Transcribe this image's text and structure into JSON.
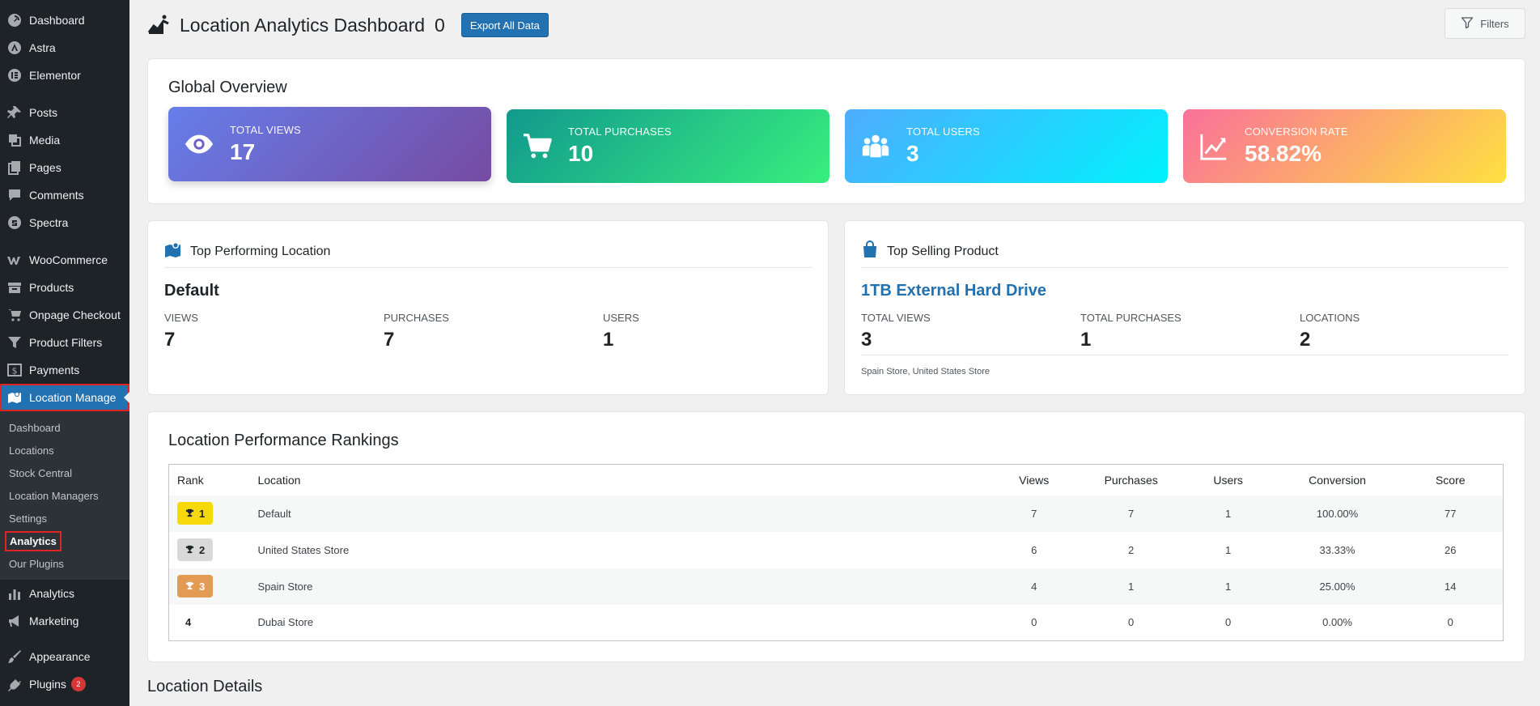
{
  "sidebar": {
    "top_items": [
      {
        "label": "Dashboard",
        "icon": "dashboard-icon"
      },
      {
        "label": "Astra",
        "icon": "astra-icon"
      },
      {
        "label": "Elementor",
        "icon": "elementor-icon"
      }
    ],
    "content_items": [
      {
        "label": "Posts",
        "icon": "pin-icon"
      },
      {
        "label": "Media",
        "icon": "media-icon"
      },
      {
        "label": "Pages",
        "icon": "pages-icon"
      },
      {
        "label": "Comments",
        "icon": "comment-icon"
      },
      {
        "label": "Spectra",
        "icon": "spectra-icon"
      }
    ],
    "shop_items": [
      {
        "label": "WooCommerce",
        "icon": "woocommerce-icon"
      },
      {
        "label": "Products",
        "icon": "archive-icon"
      },
      {
        "label": "Onpage Checkout",
        "icon": "cart-icon"
      },
      {
        "label": "Product Filters",
        "icon": "filter-icon"
      },
      {
        "label": "Payments",
        "icon": "dollar-icon"
      }
    ],
    "current_item": {
      "label": "Location Manage",
      "icon": "map-icon"
    },
    "submenu": [
      "Dashboard",
      "Locations",
      "Stock Central",
      "Location Managers",
      "Settings",
      "Analytics",
      "Our Plugins"
    ],
    "submenu_active": "Analytics",
    "bottom_items": [
      {
        "label": "Analytics",
        "icon": "bar-chart-icon"
      },
      {
        "label": "Marketing",
        "icon": "megaphone-icon"
      }
    ],
    "appearance": {
      "label": "Appearance",
      "icon": "brush-icon"
    },
    "plugins": {
      "label": "Plugins",
      "icon": "plug-icon",
      "badge": "2"
    }
  },
  "header": {
    "title": "Location Analytics Dashboard",
    "count": "0",
    "export_label": "Export All Data",
    "filters_label": "Filters"
  },
  "overview": {
    "heading": "Global Overview",
    "stats": {
      "views": {
        "label": "TOTAL VIEWS",
        "value": "17",
        "icon": "eye-icon"
      },
      "purchases": {
        "label": "TOTAL PURCHASES",
        "value": "10",
        "icon": "cart-icon"
      },
      "users": {
        "label": "TOTAL USERS",
        "value": "3",
        "icon": "users-icon"
      },
      "conversion": {
        "label": "CONVERSION RATE",
        "value": "58.82%",
        "icon": "trend-icon"
      }
    }
  },
  "top_location": {
    "heading": "Top Performing Location",
    "name": "Default",
    "metrics": [
      {
        "label": "VIEWS",
        "value": "7"
      },
      {
        "label": "PURCHASES",
        "value": "7"
      },
      {
        "label": "USERS",
        "value": "1"
      }
    ]
  },
  "top_product": {
    "heading": "Top Selling Product",
    "name": "1TB External Hard Drive",
    "metrics": [
      {
        "label": "TOTAL VIEWS",
        "value": "3"
      },
      {
        "label": "TOTAL PURCHASES",
        "value": "1"
      },
      {
        "label": "LOCATIONS",
        "value": "2"
      }
    ],
    "locations_note": "Spain Store, United States Store"
  },
  "rankings": {
    "heading": "Location Performance Rankings",
    "columns": [
      "Rank",
      "Location",
      "Views",
      "Purchases",
      "Users",
      "Conversion",
      "Score"
    ],
    "rows": [
      {
        "rank": "1",
        "location": "Default",
        "views": "7",
        "purchases": "7",
        "users": "1",
        "conversion": "100.00%",
        "score": "77",
        "badge_color": "#f5d90a"
      },
      {
        "rank": "2",
        "location": "United States Store",
        "views": "6",
        "purchases": "2",
        "users": "1",
        "conversion": "33.33%",
        "score": "26",
        "badge_color": "#d9d9d9"
      },
      {
        "rank": "3",
        "location": "Spain Store",
        "views": "4",
        "purchases": "1",
        "users": "1",
        "conversion": "25.00%",
        "score": "14",
        "badge_color": "#e39a53"
      },
      {
        "rank": "4",
        "location": "Dubai Store",
        "views": "0",
        "purchases": "0",
        "users": "0",
        "conversion": "0.00%",
        "score": "0"
      }
    ]
  },
  "details": {
    "heading": "Location Details"
  },
  "colors": {
    "sidebar_bg": "#1d2327",
    "accent": "#2271b1",
    "highlight_outline": "#e02424"
  }
}
